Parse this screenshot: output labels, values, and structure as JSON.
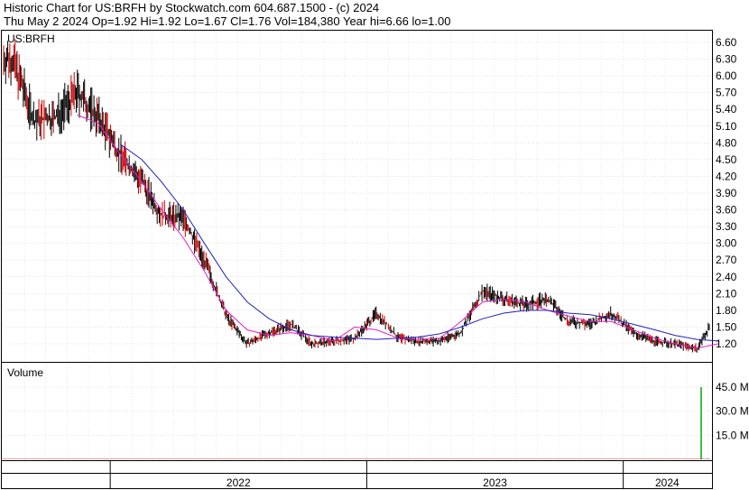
{
  "header": {
    "line1": "Historic Chart for US:BRFH by Stockwatch.com 604.687.1500 - (c) 2024",
    "line2": "Thu May  2 2024  Op=1.92  Hi=1.92  Lo=1.67  Cl=1.76  Vol=184,380  Year hi=6.66  lo=1.00"
  },
  "colors": {
    "price": "#000000",
    "ma_short": "#e020c0",
    "ma_long": "#2020c0",
    "down": "#cc0000",
    "volume_spike": "#00aa00"
  },
  "chart_data": [
    {
      "type": "line",
      "title": "US:BRFH",
      "ylim": [
        1.0,
        6.66
      ],
      "y_ticks": [
        "6.60",
        "6.30",
        "6.00",
        "5.70",
        "5.40",
        "5.10",
        "4.80",
        "4.50",
        "4.20",
        "3.90",
        "3.60",
        "3.30",
        "3.00",
        "2.70",
        "2.40",
        "2.10",
        "1.80",
        "1.50",
        "1.20"
      ],
      "x_labels": [
        "2022",
        "2023",
        "2024"
      ],
      "x_range": [
        "2021-08",
        "2024-05"
      ],
      "series": [
        {
          "role": "price",
          "x": [
            "2021-08",
            "2021-09",
            "2021-10",
            "2021-11",
            "2021-12",
            "2022-01",
            "2022-02",
            "2022-03",
            "2022-04",
            "2022-05",
            "2022-06",
            "2022-07",
            "2022-08",
            "2022-09",
            "2022-10",
            "2022-11",
            "2022-12",
            "2023-01",
            "2023-02",
            "2023-03",
            "2023-04",
            "2023-05",
            "2023-06",
            "2023-07",
            "2023-08",
            "2023-09",
            "2023-10",
            "2023-11",
            "2023-12",
            "2024-01",
            "2024-02",
            "2024-03",
            "2024-04",
            "2024-05"
          ],
          "values": [
            6.3,
            5.2,
            5.25,
            5.7,
            5.25,
            4.6,
            4.1,
            3.5,
            3.45,
            2.7,
            1.7,
            1.2,
            1.4,
            1.55,
            1.2,
            1.25,
            1.3,
            1.75,
            1.3,
            1.25,
            1.25,
            1.4,
            2.15,
            2.0,
            1.9,
            2.0,
            1.6,
            1.55,
            1.75,
            1.4,
            1.25,
            1.2,
            1.12,
            1.76
          ]
        },
        {
          "role": "ma_short",
          "x": [
            "2021-11",
            "2021-12",
            "2022-01",
            "2022-02",
            "2022-03",
            "2022-04",
            "2022-05",
            "2022-06",
            "2022-07",
            "2022-08",
            "2022-09",
            "2022-10",
            "2022-11",
            "2022-12",
            "2023-01",
            "2023-02",
            "2023-03",
            "2023-04",
            "2023-05",
            "2023-06",
            "2023-07",
            "2023-08",
            "2023-09",
            "2023-10",
            "2023-11",
            "2023-12",
            "2024-01",
            "2024-02",
            "2024-03",
            "2024-04",
            "2024-05"
          ],
          "values": [
            5.3,
            5.15,
            4.6,
            4.1,
            3.6,
            3.1,
            2.5,
            1.8,
            1.45,
            1.35,
            1.4,
            1.35,
            1.25,
            1.5,
            1.45,
            1.3,
            1.28,
            1.3,
            1.6,
            1.95,
            2.0,
            1.95,
            1.8,
            1.7,
            1.6,
            1.6,
            1.45,
            1.3,
            1.2,
            1.12,
            1.2
          ]
        },
        {
          "role": "ma_long",
          "x": [
            "2022-01",
            "2022-02",
            "2022-03",
            "2022-04",
            "2022-05",
            "2022-06",
            "2022-07",
            "2022-08",
            "2022-09",
            "2022-10",
            "2022-11",
            "2022-12",
            "2023-01",
            "2023-02",
            "2023-03",
            "2023-04",
            "2023-05",
            "2023-06",
            "2023-07",
            "2023-08",
            "2023-09",
            "2023-10",
            "2023-11",
            "2023-12",
            "2024-01",
            "2024-02",
            "2024-03",
            "2024-04",
            "2024-05"
          ],
          "values": [
            4.78,
            4.5,
            4.1,
            3.6,
            3.0,
            2.4,
            1.95,
            1.65,
            1.45,
            1.35,
            1.32,
            1.3,
            1.28,
            1.3,
            1.32,
            1.38,
            1.5,
            1.65,
            1.75,
            1.8,
            1.8,
            1.75,
            1.72,
            1.65,
            1.55,
            1.45,
            1.35,
            1.28,
            1.25
          ]
        }
      ]
    },
    {
      "type": "bar",
      "title": "Volume",
      "ylim": [
        0,
        50
      ],
      "y_ticks": [
        "45.0 M",
        "30.0 M",
        "15.0 M"
      ],
      "spikes": [
        {
          "x": "2024-04",
          "value": 45.0
        }
      ],
      "baseline": 0.4
    }
  ]
}
